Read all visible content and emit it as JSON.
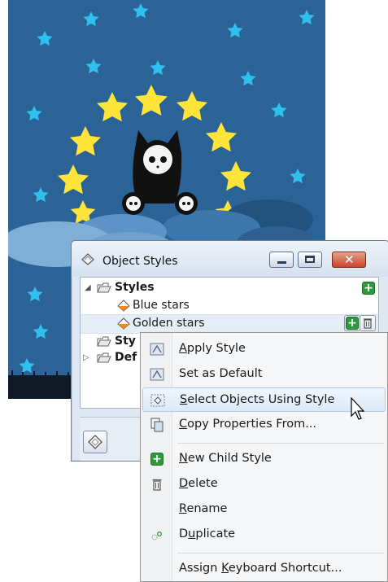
{
  "artwork": {
    "background_color": "#2b6396",
    "star_color": "#ffe43a",
    "small_star_color": "#2fc0ef",
    "cloud_color": "#7faed6"
  },
  "docker": {
    "title": "Object Styles",
    "tree": [
      {
        "label": "Styles",
        "bold": true,
        "expanded": true
      },
      {
        "label": "Blue stars",
        "bold": false
      },
      {
        "label": "Golden stars",
        "bold": false,
        "selected": true
      },
      {
        "label": "Sty",
        "bold": true,
        "expanded": false
      },
      {
        "label": "Def",
        "bold": true,
        "expanded": false
      }
    ]
  },
  "menu": {
    "items": [
      {
        "pre": "",
        "u": "A",
        "post": "pply Style",
        "icon": "apply-style-icon"
      },
      {
        "pre": "Set as Default",
        "u": "",
        "post": "",
        "icon": "set-default-icon"
      },
      {
        "pre": "",
        "u": "S",
        "post": "elect Objects Using Style",
        "icon": "select-objects-icon",
        "highlighted": true
      },
      {
        "pre": "",
        "u": "C",
        "post": "opy Properties From...",
        "icon": "copy-properties-icon"
      },
      {
        "pre": "",
        "u": "N",
        "post": "ew Child Style",
        "icon": "add-icon"
      },
      {
        "pre": "",
        "u": "D",
        "post": "elete",
        "icon": "trash-icon"
      },
      {
        "pre": "",
        "u": "R",
        "post": "ename",
        "icon": ""
      },
      {
        "pre": "D",
        "u": "u",
        "post": "plicate",
        "icon": "duplicate-icon"
      },
      {
        "pre": "Assign ",
        "u": "K",
        "post": "eyboard Shortcut...",
        "icon": ""
      }
    ]
  }
}
